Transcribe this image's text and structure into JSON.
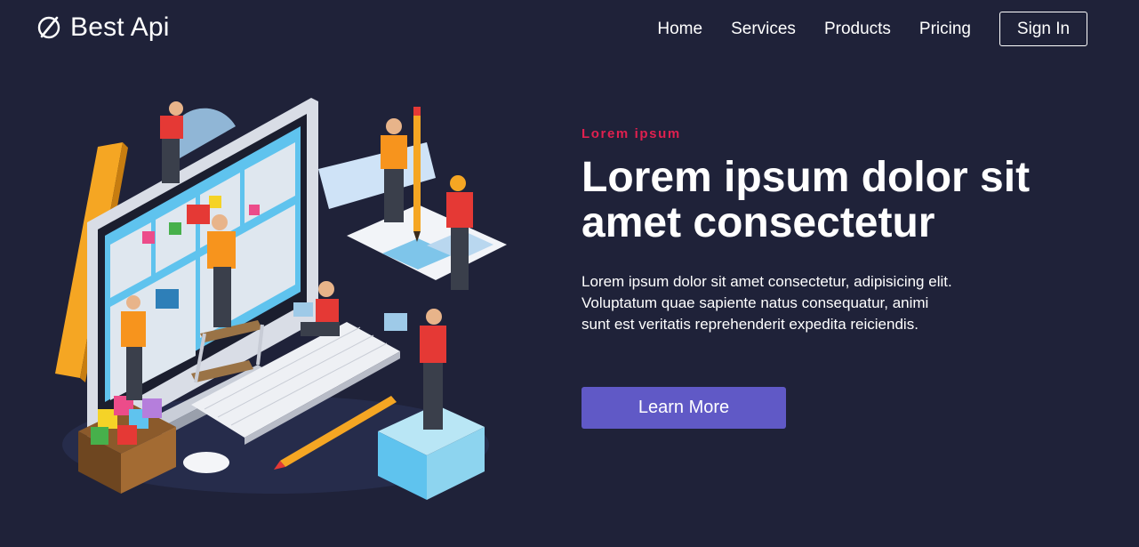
{
  "brand": {
    "name": "Best Api",
    "icon": "compass-slash-icon"
  },
  "nav": {
    "items": [
      {
        "label": "Home"
      },
      {
        "label": "Services"
      },
      {
        "label": "Products"
      },
      {
        "label": "Pricing"
      }
    ],
    "signin_label": "Sign In"
  },
  "hero": {
    "eyebrow": "Lorem ipsum",
    "headline": "Lorem ipsum dolor sit amet consectetur",
    "description": "Lorem ipsum dolor sit amet consectetur, adipisicing elit. Voluptatum quae sapiente natus consequatur, animi sunt est veritatis reprehenderit expedita reiciendis.",
    "cta_label": "Learn More",
    "illustration": "isometric-team-building-website-illustration"
  },
  "colors": {
    "background": "#1f2239",
    "accent": "#e0204f",
    "button": "#6059c6",
    "text": "#ffffff"
  }
}
